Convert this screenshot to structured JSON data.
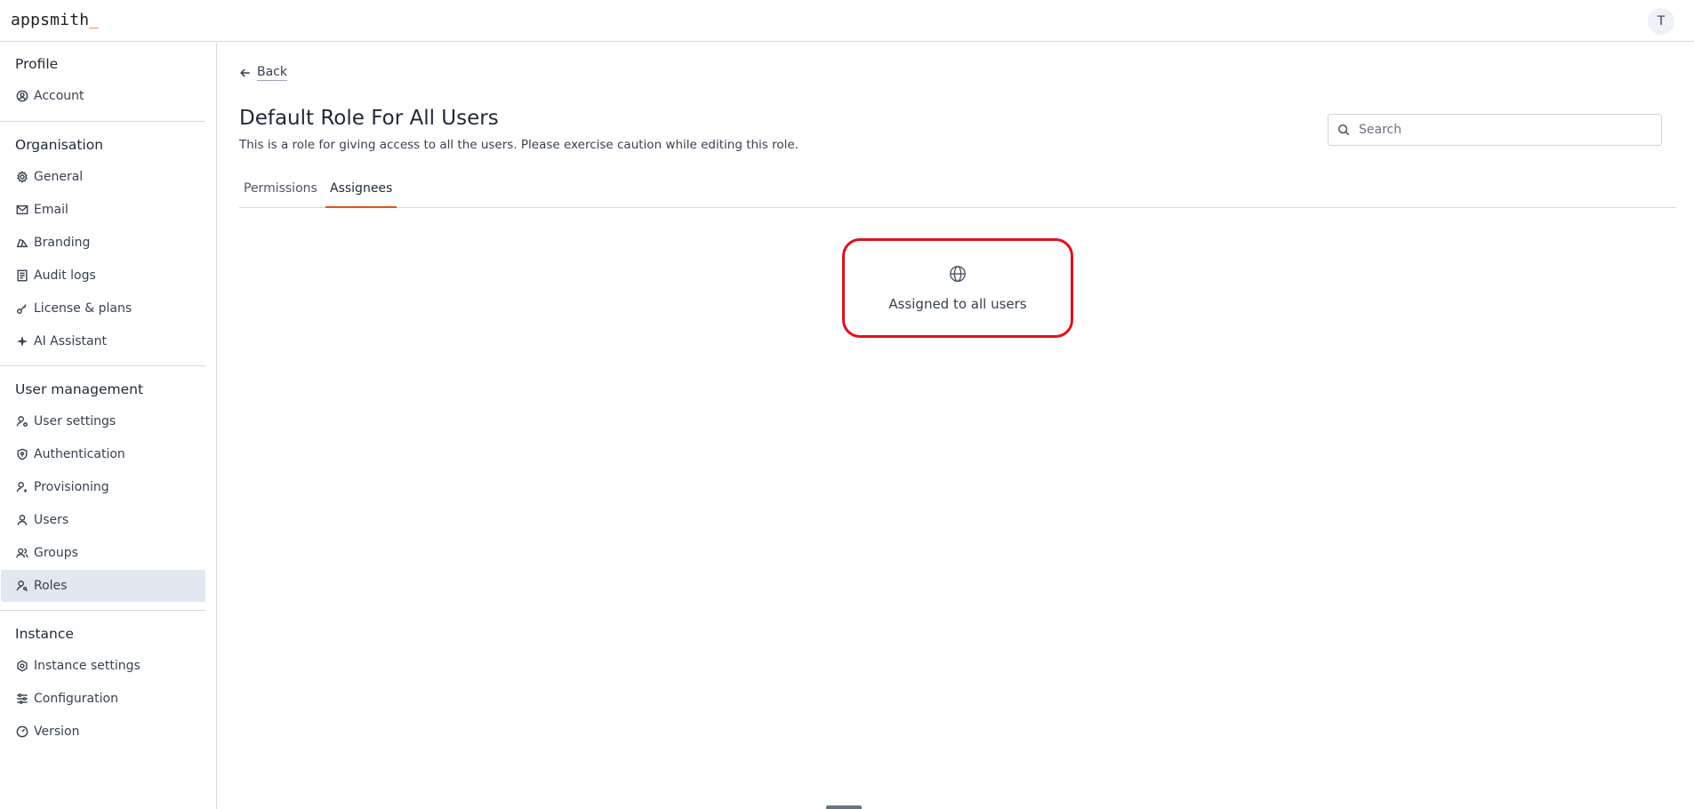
{
  "header": {
    "logo": "appsmith",
    "logo_cursor": "_",
    "avatar_initial": "T"
  },
  "sidebar": {
    "sections": [
      {
        "title": "Profile",
        "items": [
          {
            "label": "Account",
            "icon": "user-circle-icon"
          }
        ]
      },
      {
        "title": "Organisation",
        "items": [
          {
            "label": "General",
            "icon": "gear-icon"
          },
          {
            "label": "Email",
            "icon": "mail-icon"
          },
          {
            "label": "Branding",
            "icon": "palette-icon"
          },
          {
            "label": "Audit logs",
            "icon": "file-list-icon"
          },
          {
            "label": "License & plans",
            "icon": "key-icon"
          },
          {
            "label": "AI Assistant",
            "icon": "sparkle-icon"
          }
        ]
      },
      {
        "title": "User management",
        "items": [
          {
            "label": "User settings",
            "icon": "user-gear-icon"
          },
          {
            "label": "Authentication",
            "icon": "shield-lock-icon"
          },
          {
            "label": "Provisioning",
            "icon": "user-sync-icon"
          },
          {
            "label": "Users",
            "icon": "user-icon"
          },
          {
            "label": "Groups",
            "icon": "group-icon"
          },
          {
            "label": "Roles",
            "icon": "user-key-icon",
            "active": true
          }
        ]
      },
      {
        "title": "Instance",
        "items": [
          {
            "label": "Instance settings",
            "icon": "hexagon-gear-icon"
          },
          {
            "label": "Configuration",
            "icon": "sliders-icon"
          },
          {
            "label": "Version",
            "icon": "gauge-icon"
          }
        ]
      }
    ]
  },
  "main": {
    "back_label": "Back",
    "title": "Default Role For All Users",
    "description": "This is a role for giving access to all the users. Please exercise caution while editing this role.",
    "search_placeholder": "Search",
    "tabs": [
      {
        "label": "Permissions"
      },
      {
        "label": "Assignees",
        "active": true
      }
    ],
    "assigned_card": {
      "icon": "globe-icon",
      "text": "Assigned to all users"
    }
  },
  "colors": {
    "accent": "#e15615",
    "highlight_border": "#e0101e",
    "active_nav_bg": "#e2e8f0"
  }
}
